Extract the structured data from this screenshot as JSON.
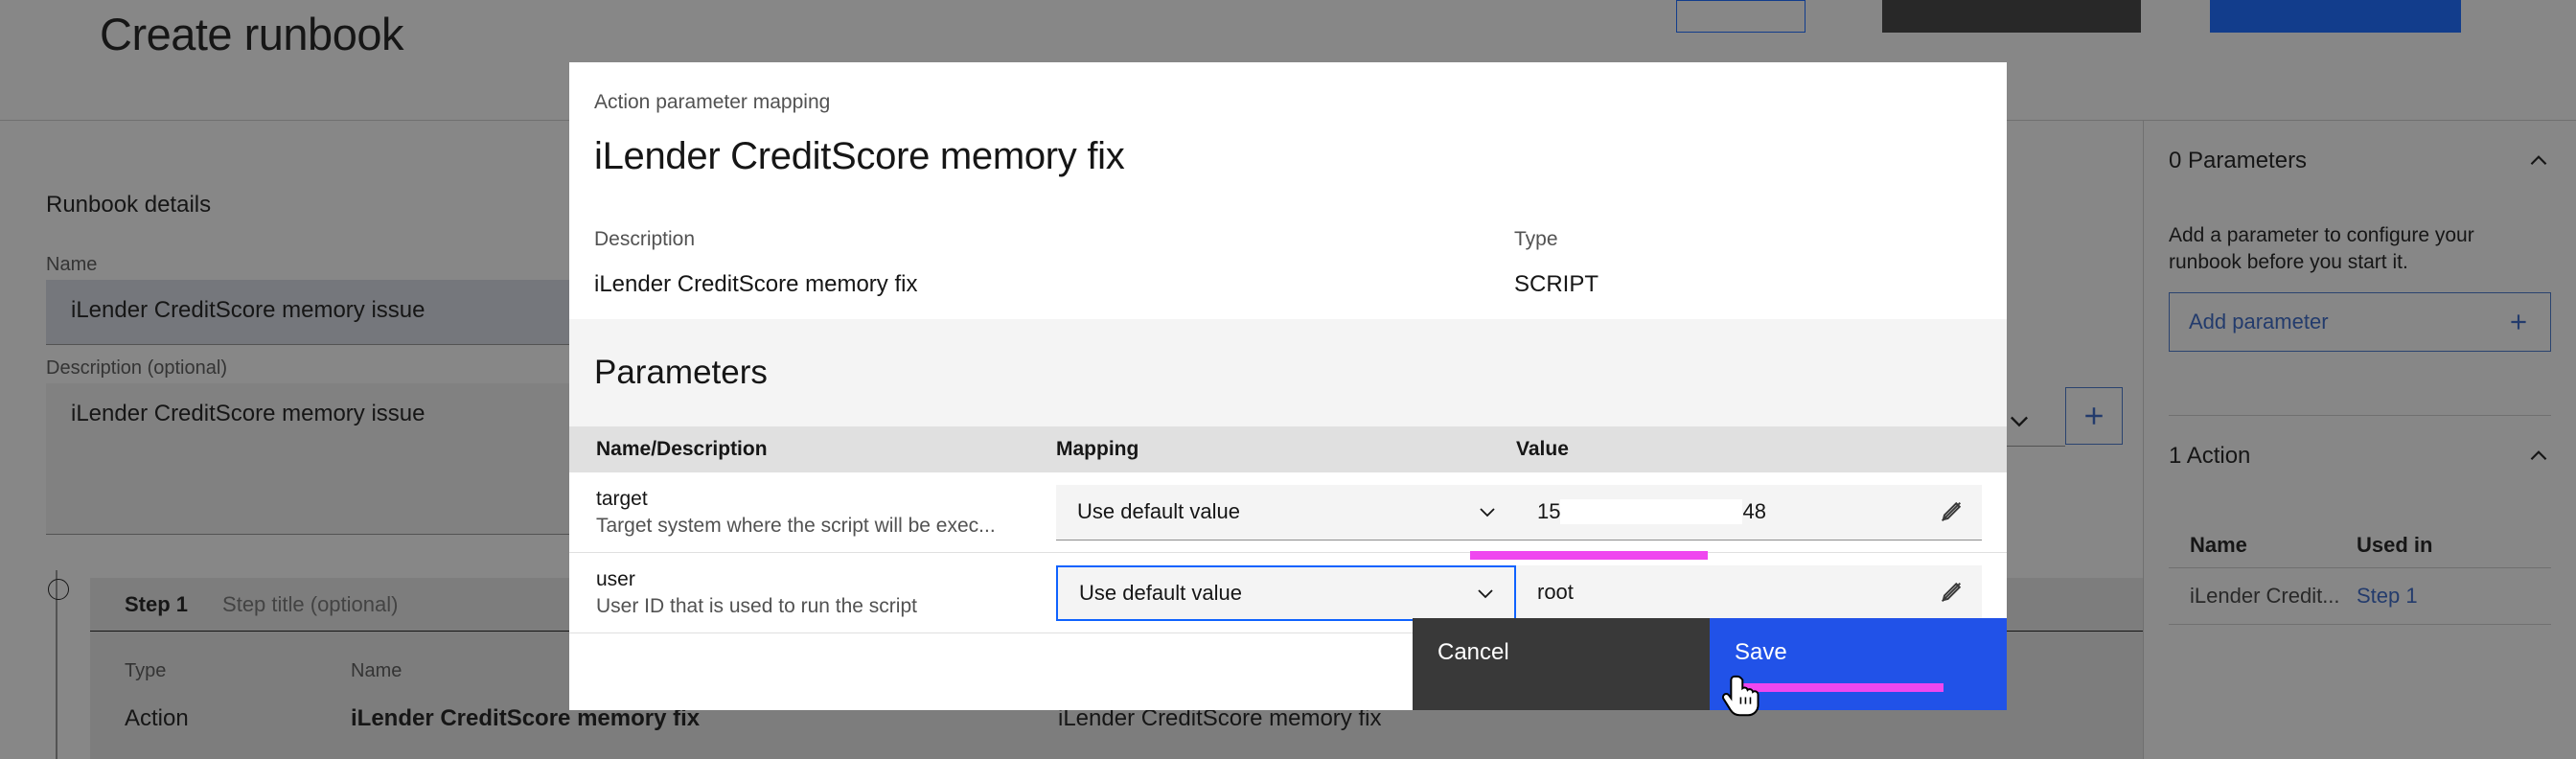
{
  "page": {
    "title": "Create runbook"
  },
  "topbar": {
    "buttons": [
      {
        "name": "ghost-button",
        "label": ""
      },
      {
        "name": "dark-button",
        "label": ""
      },
      {
        "name": "primary-button",
        "label": ""
      }
    ]
  },
  "runbook_details": {
    "heading": "Runbook details",
    "name_label": "Name",
    "name_value": "iLender CreditScore memory issue",
    "description_label": "Description (optional)",
    "description_value": "iLender CreditScore memory issue"
  },
  "step": {
    "number": "Step 1",
    "title_placeholder": "Step title (optional)",
    "columns": {
      "type": "Type",
      "name": "Name",
      "description": ""
    },
    "row": {
      "type": "Action",
      "name": "iLender CreditScore memory fix",
      "description": "iLender CreditScore memory fix"
    }
  },
  "right_panel": {
    "parameters": {
      "title": "0 Parameters",
      "help": "Add a parameter to configure your runbook before you start it.",
      "add_label": "Add parameter"
    },
    "actions": {
      "title": "1 Action",
      "columns": [
        "Name",
        "Used in"
      ],
      "rows": [
        {
          "name": "iLender Credit...",
          "used_in": "Step 1"
        }
      ]
    }
  },
  "modal": {
    "eyebrow": "Action parameter mapping",
    "title": "iLender CreditScore memory fix",
    "description_label": "Description",
    "description_value": "iLender CreditScore memory fix",
    "type_label": "Type",
    "type_value": "SCRIPT",
    "parameters_heading": "Parameters",
    "table": {
      "columns": [
        "Name/Description",
        "Mapping",
        "Value"
      ],
      "rows": [
        {
          "name": "target",
          "description": "Target system where the script will be exec...",
          "mapping": "Use default value",
          "value_prefix": "15",
          "value_suffix": "48",
          "value_redacted": true,
          "focused": false
        },
        {
          "name": "user",
          "description": "User ID that is used to run the script",
          "mapping": "Use default value",
          "value_prefix": "root",
          "value_suffix": "",
          "value_redacted": false,
          "focused": true
        }
      ]
    },
    "cancel_label": "Cancel",
    "save_label": "Save"
  },
  "colors": {
    "accent_blue": "#0f62fe",
    "save_blue": "#2152e8",
    "dark": "#393939",
    "annotation_magenta": "#ef47ef",
    "link_blue": "#2f5fbe"
  }
}
